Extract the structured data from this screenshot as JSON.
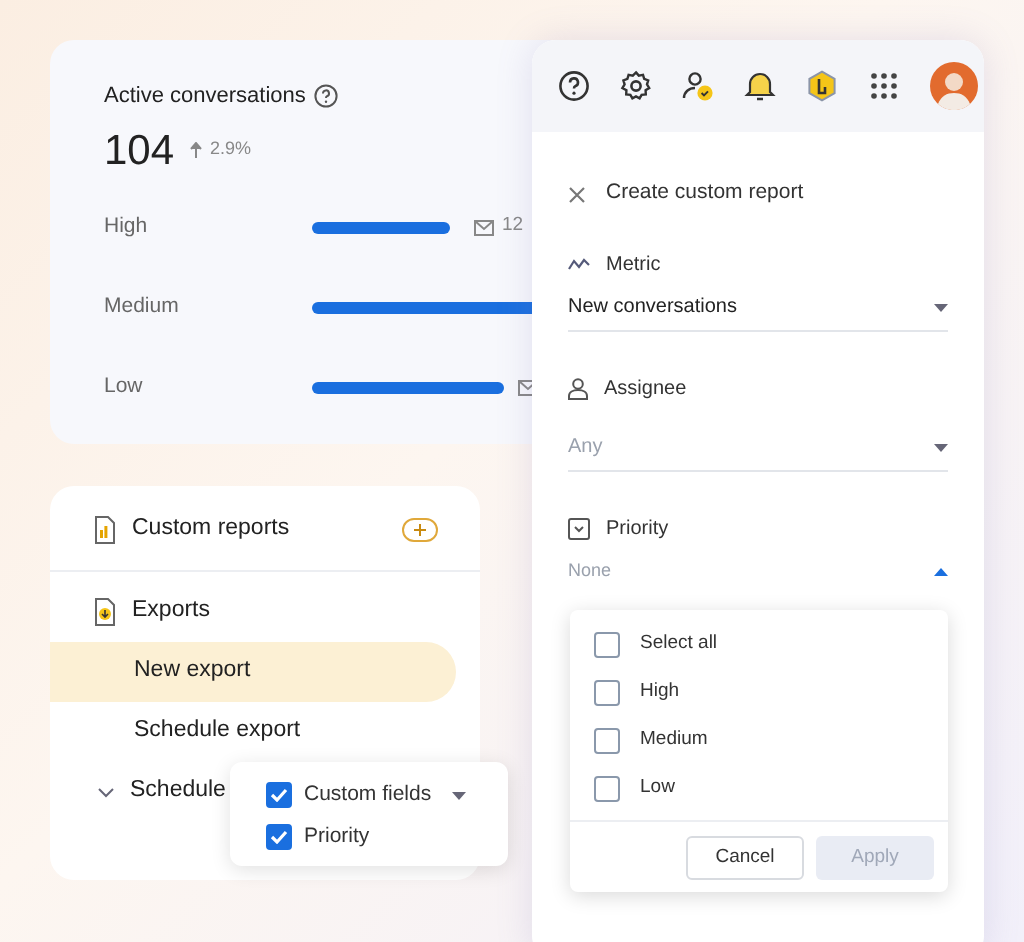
{
  "stats": {
    "title": "Active conversations",
    "value": "104",
    "change": "2.9%",
    "rows": [
      {
        "label": "High",
        "kind": "with-count",
        "count": "12"
      },
      {
        "label": "Medium",
        "kind": "bar-only"
      },
      {
        "label": "Low",
        "kind": "icon-only"
      }
    ]
  },
  "nav": {
    "items": [
      {
        "kind": "report-header",
        "label": "Custom reports",
        "has_add": true
      },
      {
        "kind": "export-header",
        "label": "Exports",
        "has_add": false
      },
      {
        "kind": "sub",
        "label": "New export",
        "selected": true
      },
      {
        "kind": "sub",
        "label": "Schedule export",
        "selected": false
      },
      {
        "kind": "group",
        "label": "Schedule",
        "expanded": false
      }
    ]
  },
  "popup": {
    "items": [
      {
        "label": "Custom fields",
        "checked": true,
        "has_caret": true
      },
      {
        "label": "Priority",
        "checked": true,
        "has_caret": false
      }
    ]
  },
  "panel": {
    "title": "Create custom report",
    "fields": [
      {
        "kind": "metric",
        "label": "Metric",
        "value": "New conversations"
      },
      {
        "kind": "assignee",
        "label": "Assignee",
        "placeholder": "Any"
      },
      {
        "kind": "priority",
        "label": "Priority",
        "placeholder": "None",
        "expanded": true
      }
    ],
    "dropdown": {
      "options": [
        {
          "label": "Select all",
          "checked": false
        },
        {
          "label": "High",
          "checked": false
        },
        {
          "label": "Medium",
          "checked": false
        },
        {
          "label": "Low",
          "checked": false
        }
      ],
      "buttons": [
        {
          "label": "Cancel",
          "disabled": false
        },
        {
          "label": "Apply",
          "disabled": true
        }
      ]
    }
  }
}
